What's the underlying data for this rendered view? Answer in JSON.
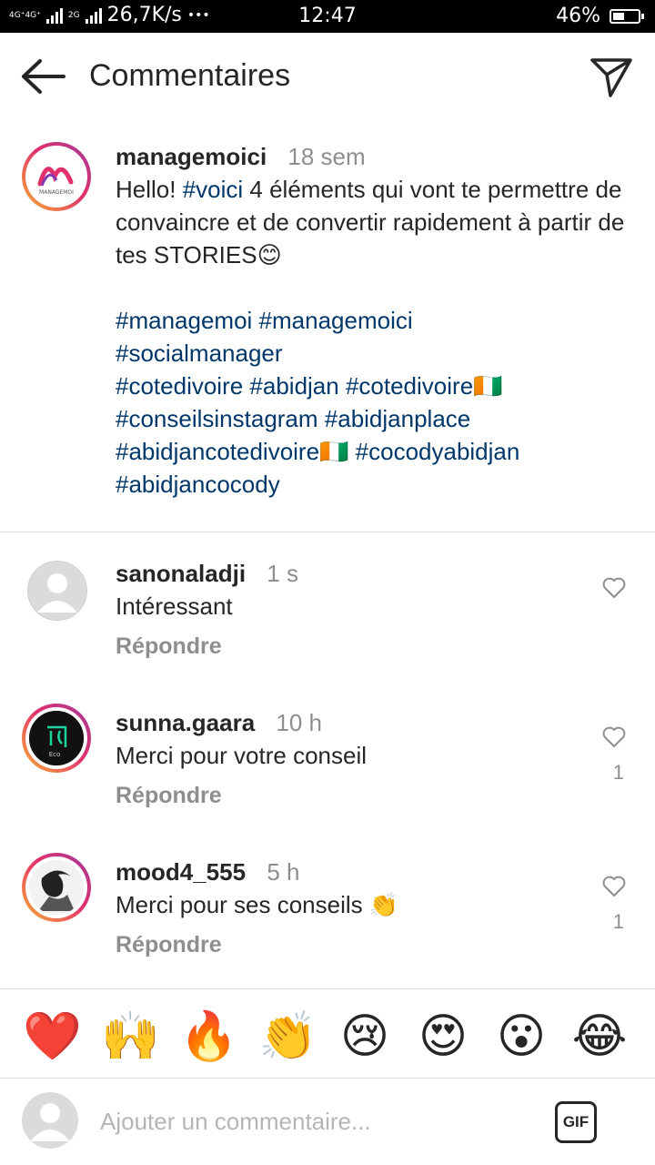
{
  "status_bar": {
    "network": "4G⁺4G⁺",
    "network2": "2G",
    "speed": "26,7K/s",
    "dots": "•••",
    "time": "12:47",
    "battery_text": "46%",
    "battery_level": 0.46
  },
  "header": {
    "title": "Commentaires",
    "back_icon": "arrow-left-icon",
    "send_icon": "paper-plane-icon"
  },
  "post": {
    "username": "managemoici",
    "time": "18 sem",
    "avatar_text": "MANAGEMOI",
    "text_start": "Hello! ",
    "tag_voici": "#voici",
    "text_main": " 4 éléments qui vont te permettre de convaincre et de convertir rapidement à partir de tes STORIES",
    "emoji_smile": "😊",
    "hashtags_1": "#managemoi #managemoici",
    "hashtags_2": "#socialmanager",
    "hashtags_3": "#cotedivoire #abidjan #cotedivoire",
    "flag": "🇨🇮",
    "hashtags_4": "#conseilsinstagram #abidjanplace",
    "hashtags_5a": "#abidjancotedivoire",
    "hashtags_5b": " #cocodyabidjan",
    "hashtags_6": "#abidjancocody"
  },
  "comments": [
    {
      "username": "sanonaladji",
      "time": "1 s",
      "text": "Intéressant",
      "reply": "Répondre",
      "likes": ""
    },
    {
      "username": "sunna.gaara",
      "time": "10 h",
      "text": "Merci pour votre conseil",
      "reply": "Répondre",
      "likes": "1",
      "avatar_text": "Eco"
    },
    {
      "username": "mood4_555",
      "time": "5 h",
      "text": "Merci pour ses conseils ",
      "emoji": "👏",
      "reply": "Répondre",
      "likes": "1"
    }
  ],
  "emoji_bar": [
    "❤️",
    "🙌",
    "🔥",
    "👏",
    "😢",
    "😍",
    "😮",
    "😂"
  ],
  "input": {
    "placeholder": "Ajouter un commentaire...",
    "gif_label": "GIF"
  },
  "colors": {
    "hashtag": "#00376b",
    "muted": "#8e8e8e",
    "text": "#262626",
    "divider": "#dbdbdb"
  }
}
